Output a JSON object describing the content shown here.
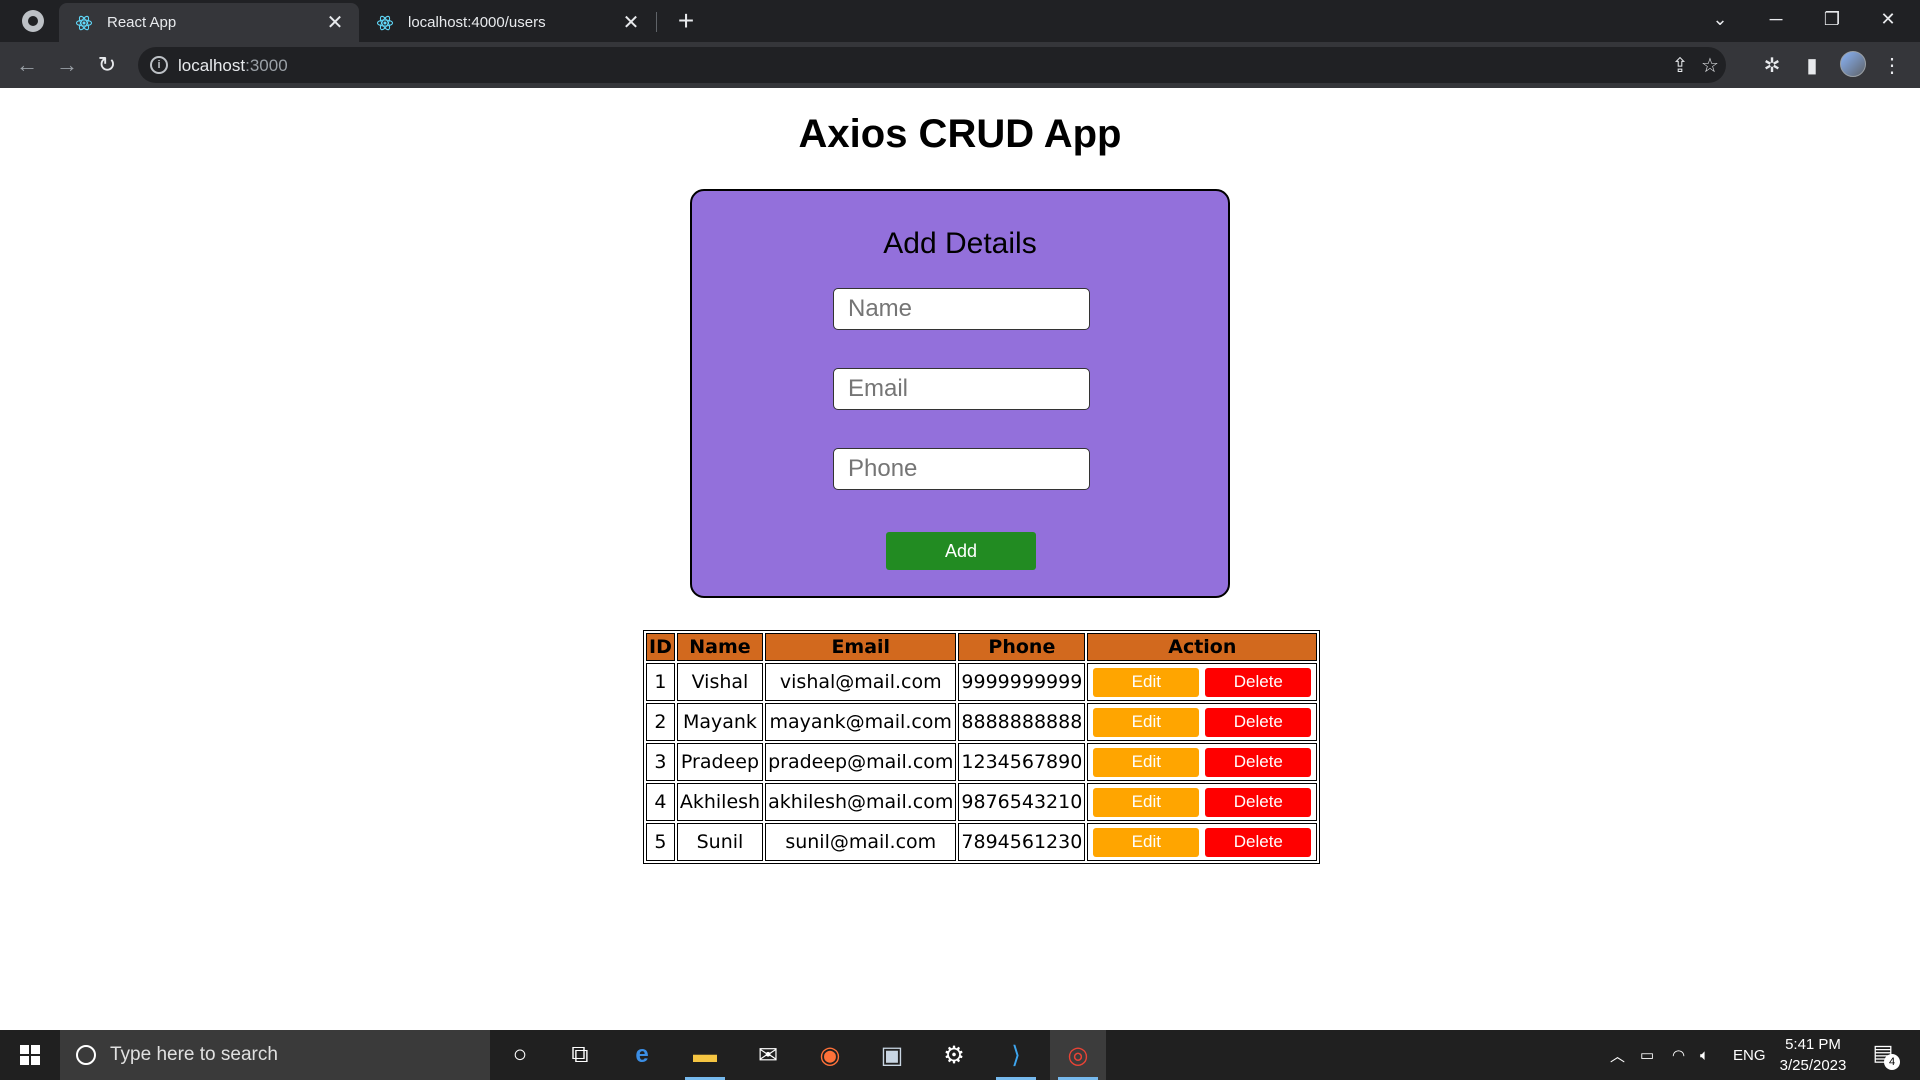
{
  "browser": {
    "tabs": [
      {
        "title": "React App",
        "active": true
      },
      {
        "title": "localhost:4000/users",
        "active": false
      }
    ],
    "address": {
      "host": "localhost",
      "port": ":3000"
    }
  },
  "page": {
    "title": "Axios CRUD App",
    "form": {
      "title": "Add Details",
      "name_placeholder": "Name",
      "email_placeholder": "Email",
      "phone_placeholder": "Phone",
      "add_label": "Add"
    },
    "table": {
      "headers": [
        "ID",
        "Name",
        "Email",
        "Phone",
        "Action"
      ],
      "edit_label": "Edit",
      "delete_label": "Delete",
      "rows": [
        {
          "id": "1",
          "name": "Vishal",
          "email": "vishal@mail.com",
          "phone": "9999999999"
        },
        {
          "id": "2",
          "name": "Mayank",
          "email": "mayank@mail.com",
          "phone": "8888888888"
        },
        {
          "id": "3",
          "name": "Pradeep",
          "email": "pradeep@mail.com",
          "phone": "1234567890"
        },
        {
          "id": "4",
          "name": "Akhilesh",
          "email": "akhilesh@mail.com",
          "phone": "9876543210"
        },
        {
          "id": "5",
          "name": "Sunil",
          "email": "sunil@mail.com",
          "phone": "7894561230"
        }
      ]
    }
  },
  "taskbar": {
    "search_placeholder": "Type here to search",
    "language": "ENG",
    "time": "5:41 PM",
    "date": "3/25/2023",
    "notification_count": "4"
  },
  "colors": {
    "form_bg": "#9370db",
    "add_button": "#228b22",
    "table_header": "#d2691e",
    "edit_button": "#ffa500",
    "delete_button": "#ff0000"
  }
}
